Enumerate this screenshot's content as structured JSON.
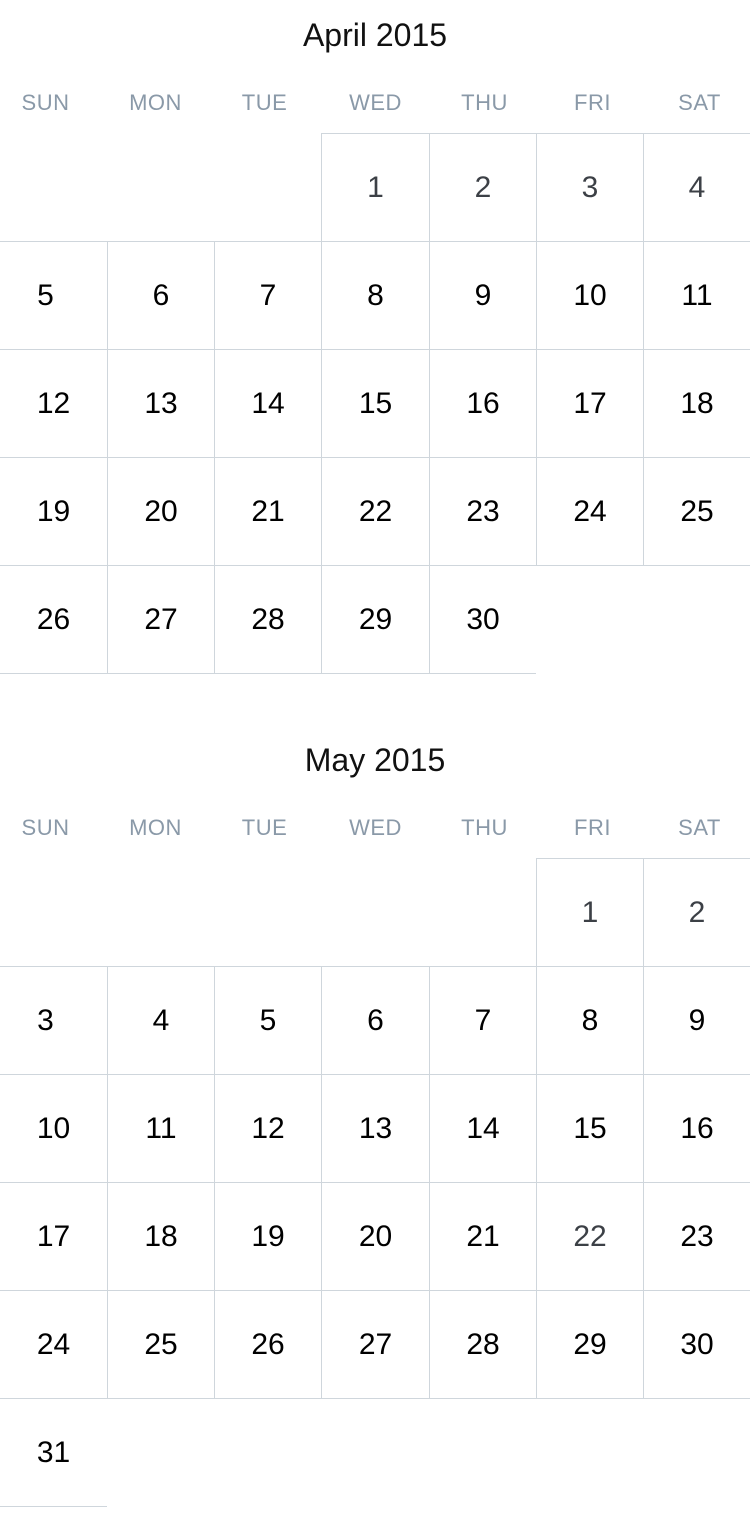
{
  "weekdays": [
    "SUN",
    "MON",
    "TUE",
    "WED",
    "THU",
    "FRI",
    "SAT"
  ],
  "months": [
    {
      "title": "April 2015",
      "first_weekday": 3,
      "days_in_month": 30,
      "dim_days": [
        1,
        2,
        3,
        4
      ]
    },
    {
      "title": "May 2015",
      "first_weekday": 5,
      "days_in_month": 31,
      "dim_days": [
        1,
        2,
        22
      ]
    }
  ]
}
